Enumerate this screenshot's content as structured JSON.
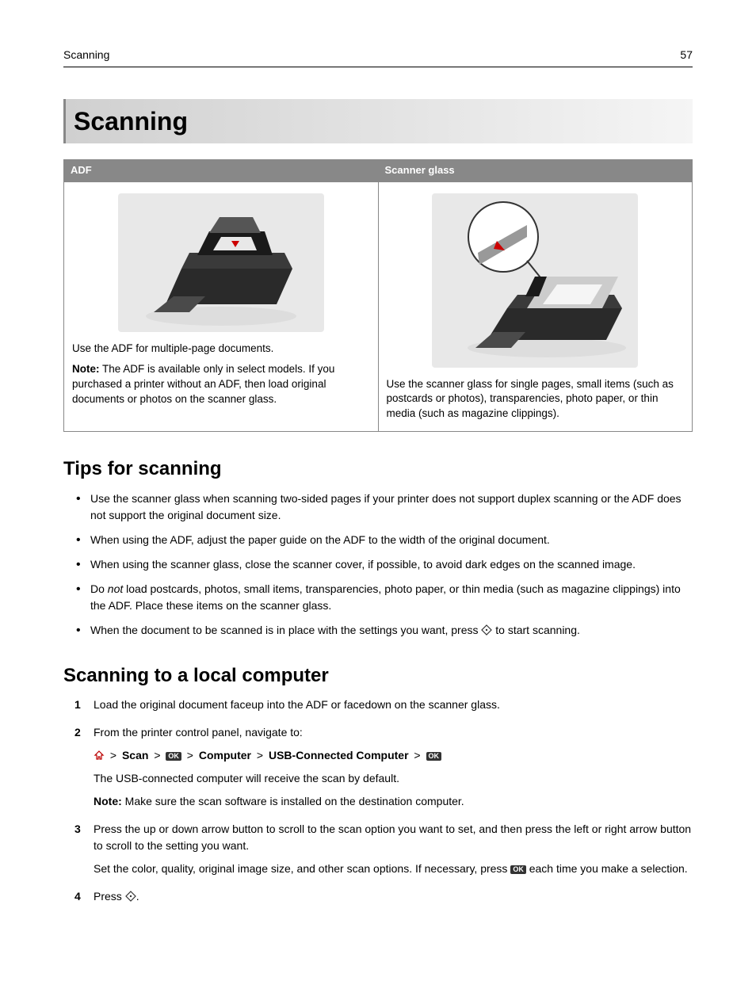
{
  "header": {
    "section": "Scanning",
    "page_number": "57"
  },
  "chapter_title": "Scanning",
  "compare": {
    "col1": {
      "header": "ADF",
      "line1": "Use the ADF for multiple‑page documents.",
      "note_label": "Note:",
      "note_text": " The ADF is available only in select models. If you purchased a printer without an ADF, then load original documents or photos on the scanner glass."
    },
    "col2": {
      "header": "Scanner glass",
      "text": "Use the scanner glass for single pages, small items (such as postcards or photos), transparencies, photo paper, or thin media (such as magazine clippings)."
    }
  },
  "tips": {
    "heading": "Tips for scanning",
    "items": {
      "b1": "Use the scanner glass when scanning two‑sided pages if your printer does not support duplex scanning or the ADF does not support the original document size.",
      "b2": "When using the ADF, adjust the paper guide on the ADF to the width of the original document.",
      "b3": "When using the scanner glass, close the scanner cover, if possible, to avoid dark edges on the scanned image.",
      "b4_pre": "Do ",
      "b4_em": "not",
      "b4_post": " load postcards, photos, small items, transparencies, photo paper, or thin media (such as magazine clippings) into the ADF. Place these items on the scanner glass.",
      "b5_pre": "When the document to be scanned is in place with the settings you want, press ",
      "b5_post": " to start scanning."
    }
  },
  "local": {
    "heading": "Scanning to a local computer",
    "s1": "Load the original document faceup into the ADF or facedown on the scanner glass.",
    "s2_intro": "From the printer control panel, navigate to:",
    "nav": {
      "sep": ">",
      "scan": "Scan",
      "computer": "Computer",
      "usb": "USB‑Connected Computer",
      "ok": "OK"
    },
    "s2_line": "The USB‑connected computer will receive the scan by default.",
    "s2_note_label": "Note:",
    "s2_note_text": " Make sure the scan software is installed on the destination computer.",
    "s3_a": "Press the up or down arrow button to scroll to the scan option you want to set, and then press the left or right arrow button to scroll to the setting you want.",
    "s3_b_pre": "Set the color, quality, original image size, and other scan options. If necessary, press ",
    "s3_b_post": " each time you make a selection.",
    "s4_pre": "Press ",
    "s4_post": "."
  }
}
